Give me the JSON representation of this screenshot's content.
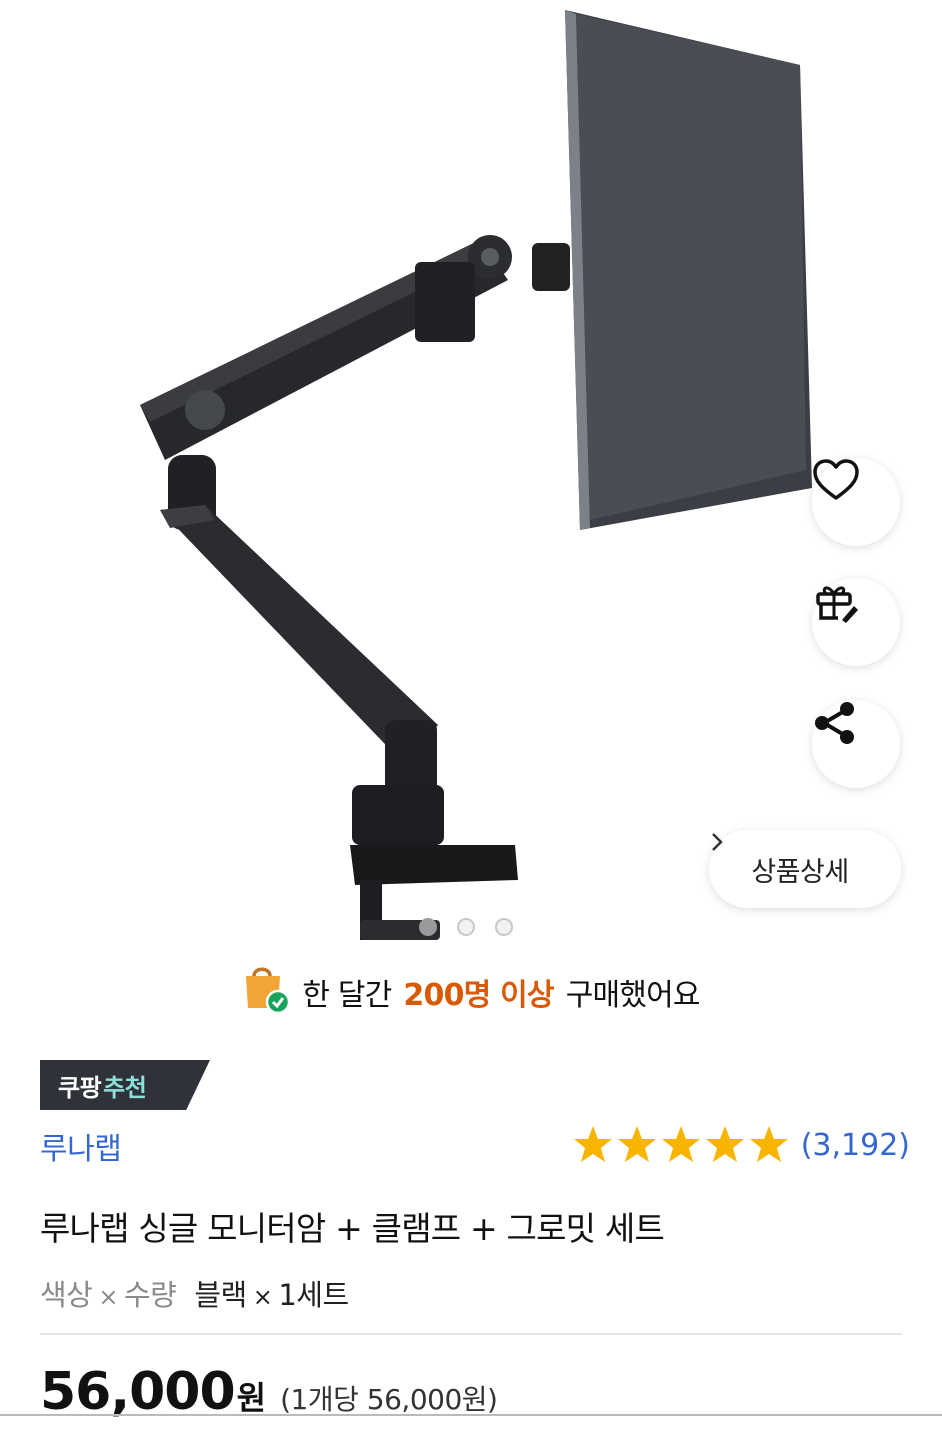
{
  "image_actions": {
    "wishlist_icon": "heart-icon",
    "gift_icon": "gift-icon",
    "share_icon": "share-icon",
    "detail_label": "상품상세",
    "detail_chevron": "›"
  },
  "carousel": {
    "total": 3,
    "current": 1
  },
  "purchase_notice": {
    "prefix": "한 달간",
    "highlight": "200명 이상",
    "suffix": "구매했어요"
  },
  "badge": {
    "part1": "쿠팡",
    "part2": "추천"
  },
  "product": {
    "brand": "루나랩",
    "rating_stars": 5,
    "review_count": "(3,192)",
    "title": "루나랩 싱글 모니터암 + 클램프 + 그로밋 세트",
    "option_key1": "색상",
    "option_key2": "수량",
    "option_sep": "×",
    "option_val1": "블랙",
    "option_val2": "1세트",
    "price": "56,000",
    "currency": "원",
    "unit_price": "(1개당 56,000원)"
  },
  "colors": {
    "link_blue": "#3467d2",
    "highlight_orange": "#d95a06",
    "star_yellow": "#f7b500",
    "badge_bg": "#2f3339",
    "badge_accent": "#8de0d9"
  }
}
